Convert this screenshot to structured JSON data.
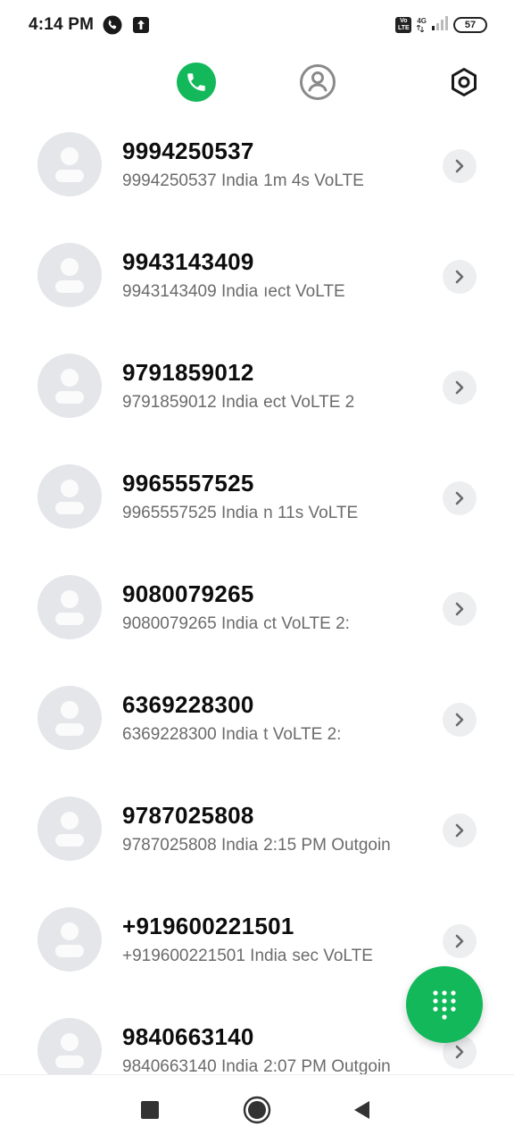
{
  "status_bar": {
    "time": "4:14 PM",
    "network": "4G",
    "battery": "57",
    "volte_top": "Vo",
    "volte_bottom": "LTE"
  },
  "top_nav": {
    "active_tab": "calls",
    "accent_color": "#12b85a",
    "icons": [
      "phone-icon",
      "contacts-icon",
      "settings-icon"
    ]
  },
  "calls": [
    {
      "name": "9994250537",
      "number_location": "9994250537 India",
      "info": "1m 4s VoLTE"
    },
    {
      "name": "9943143409",
      "number_location": "9943143409 India",
      "info": "ıect VoLTE"
    },
    {
      "name": "9791859012",
      "number_location": "9791859012 India",
      "info": "ect VoLTE        2"
    },
    {
      "name": "9965557525",
      "number_location": "9965557525 India",
      "info": "n 11s VoLTE"
    },
    {
      "name": "9080079265",
      "number_location": "9080079265 India",
      "info": "ct VoLTE          2:"
    },
    {
      "name": "6369228300",
      "number_location": "6369228300 India",
      "info": "t VoLTE          2:"
    },
    {
      "name": "9787025808",
      "number_location": "9787025808 India",
      "info": "2:15 PM Outgoin"
    },
    {
      "name": "+919600221501",
      "number_location": "+919600221501 India",
      "info": "sec VoLTE"
    },
    {
      "name": "9840663140",
      "number_location": "9840663140 India",
      "info": "2:07 PM Outgoin"
    }
  ],
  "fab": {
    "icon": "dialpad-icon"
  },
  "system_nav": {
    "icons": [
      "recent-apps-icon",
      "home-icon",
      "back-icon"
    ]
  }
}
